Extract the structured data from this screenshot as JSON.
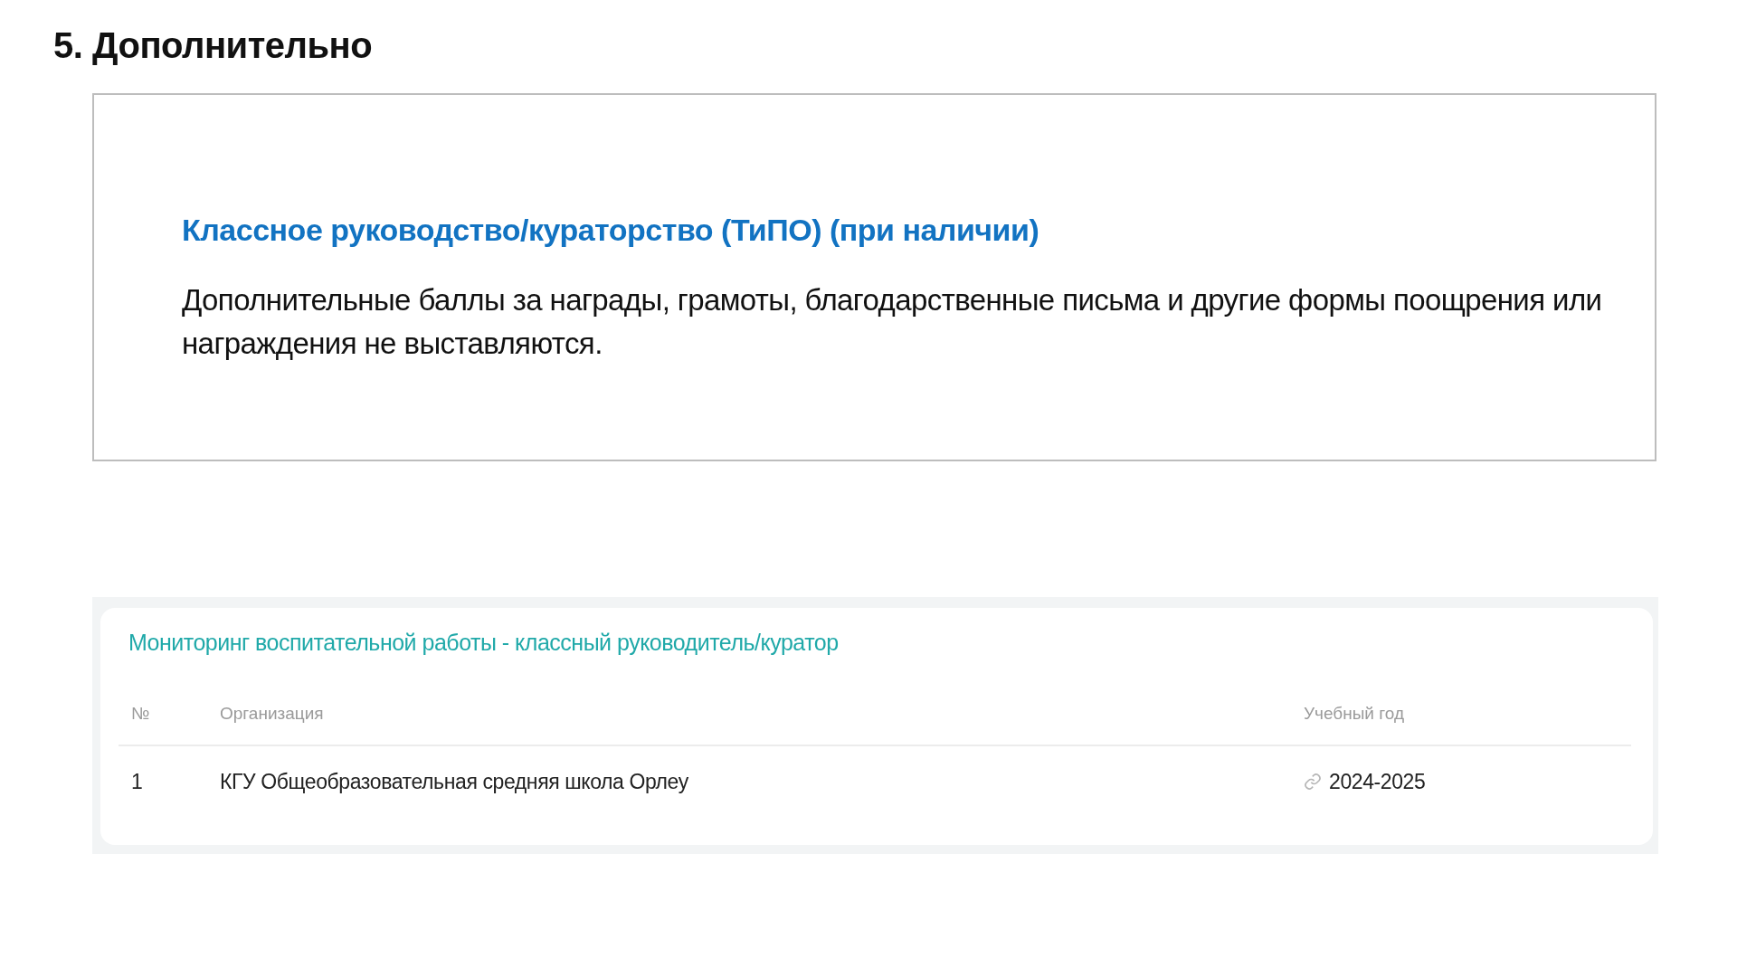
{
  "heading": "5. Дополнительно",
  "info_box": {
    "title": "Классное руководство/кураторство (ТиПО) (при наличии)",
    "text": "Дополнительные баллы за награды, грамоты, благодарственные письма и другие формы поощрения или награждения не выставляются."
  },
  "monitoring": {
    "title": "Мониторинг воспитательной работы - классный руководитель/куратор",
    "columns": [
      "№",
      "Организация",
      "Учебный год"
    ],
    "rows": [
      {
        "number": "1",
        "organization": "КГУ Общеобразовательная средняя школа Орлеу",
        "year": "2024-2025"
      }
    ]
  }
}
